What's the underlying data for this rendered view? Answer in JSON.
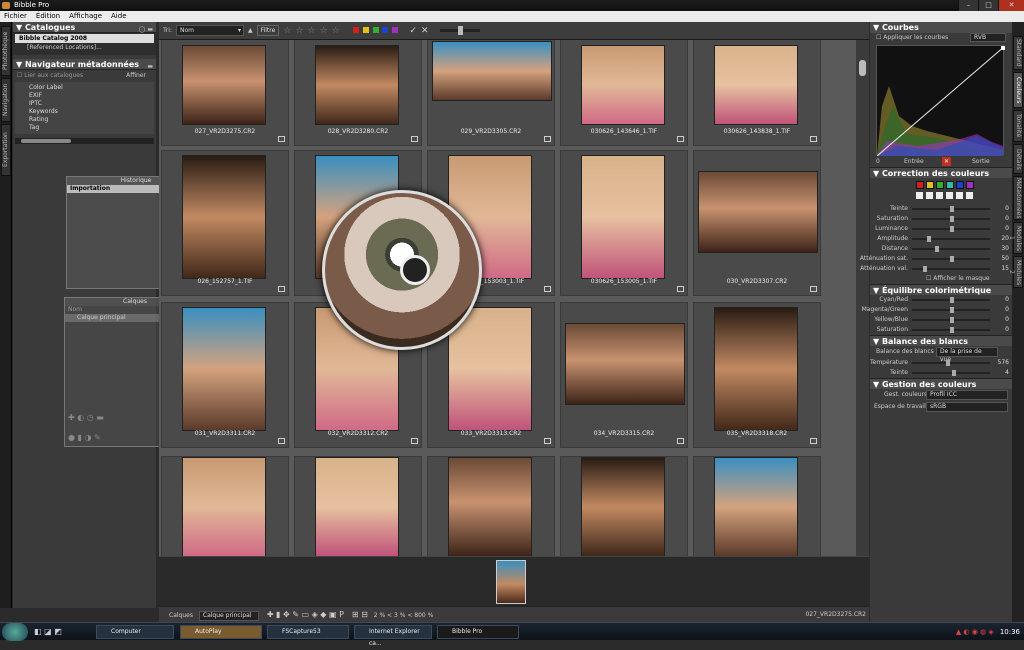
{
  "window": {
    "title": "Bibble Pro"
  },
  "menu": [
    "Fichier",
    "Édition",
    "Affichage",
    "Aide"
  ],
  "left_tabs": [
    "Photothèque",
    "Navigation",
    "Exportation"
  ],
  "catalogs": {
    "title": "Catalogues",
    "items": [
      "Bibble Catalog 2008",
      "[Referenced Locations]..."
    ]
  },
  "metadata": {
    "title": "Navigateur métadonnées",
    "link_option": "Lier aux catalogues",
    "refine_label": "Affiner",
    "items": [
      "Color Label",
      "EXIF",
      "IPTC",
      "Keywords",
      "Rating",
      "Tag"
    ]
  },
  "history": {
    "title": "Historique",
    "items": [
      "Importation"
    ]
  },
  "layers": {
    "title": "Calques",
    "column": "Nom",
    "items": [
      "Calque principal"
    ]
  },
  "toolbar": {
    "sort_label": "Tri:",
    "sort_value": "Nom",
    "filter_label": "Filtre",
    "label_colors": [
      "#d02020",
      "#e0c020",
      "#30b030",
      "#2040d0",
      "#a030c0"
    ]
  },
  "thumbnails": [
    [
      "027_VR2D3275.CR2",
      "028_VR2D3280.CR2",
      "029_VR2D3305.CR2",
      "030626_143646_1.TIF",
      "030626_143838_1.TIF"
    ],
    [
      "026_152757_1.TIF",
      "",
      "030626_153003_1.TIF",
      "030626_153005_1.TIF",
      "030_VR2D3307.CR2"
    ],
    [
      "031_VR2D3311.CR2",
      "032_VR2D3312.CR2",
      "033_VR2D3313.CR2",
      "034_VR2D3315.CR2",
      "035_VR2D3318.CR2"
    ],
    [
      "",
      "",
      "",
      "",
      ""
    ]
  ],
  "bottombar": {
    "layers_label": "Calques",
    "layer_value": "Calque principal",
    "zoom": "2 % < 3 % < 800 %",
    "filename": "027_VR2D3275.CR2"
  },
  "curves": {
    "title": "Courbes",
    "apply_label": "Appliquer les courbes",
    "channel": "RVB",
    "input_label": "Entrée",
    "output_label": "Sortie",
    "input_value": "0",
    "output_value": "0"
  },
  "color_correction": {
    "title": "Correction des couleurs",
    "swatches": [
      "#d02020",
      "#e0c020",
      "#30b030",
      "#2fbfa0",
      "#2040d0",
      "#a030c0"
    ],
    "rows": [
      {
        "label": "Teinte",
        "value": "0",
        "pos": 0.5
      },
      {
        "label": "Saturation",
        "value": "0",
        "pos": 0.5
      },
      {
        "label": "Luminance",
        "value": "0",
        "pos": 0.5
      },
      {
        "label": "Amplitude",
        "value": "20",
        "pos": 0.2
      },
      {
        "label": "Distance",
        "value": "30",
        "pos": 0.3
      },
      {
        "label": "Atténuation sat.",
        "value": "50",
        "pos": 0.5
      },
      {
        "label": "Atténuation val.",
        "value": "15",
        "pos": 0.15
      }
    ],
    "mask_label": "Afficher le masque"
  },
  "color_balance": {
    "title": "Équilibre colorimétrique",
    "rows": [
      {
        "label": "Cyan/Red",
        "value": "0",
        "pos": 0.5
      },
      {
        "label": "Magenta/Green",
        "value": "0",
        "pos": 0.5
      },
      {
        "label": "Yellow/Blue",
        "value": "0",
        "pos": 0.5
      },
      {
        "label": "Saturation",
        "value": "0",
        "pos": 0.5
      }
    ]
  },
  "white_balance": {
    "title": "Balance des blancs",
    "mode_label": "Balance des blancs",
    "mode_value": "De la prise de vue",
    "rows": [
      {
        "label": "Température",
        "value": "576",
        "pos": 0.45
      },
      {
        "label": "Teinte",
        "value": "4",
        "pos": 0.52
      }
    ]
  },
  "color_management": {
    "title": "Gestion des couleurs",
    "profile_label": "Gest. couleurs",
    "profile_value": "Profil ICC",
    "space_label": "Espace de travail",
    "space_value": "sRGB"
  },
  "right_tabs": [
    "Standard",
    "Couleurs",
    "Tonalité",
    "Détails",
    "Métadonnées",
    "Modules 1",
    "Modules 2"
  ],
  "taskbar": {
    "items": [
      "Computer",
      "AutoPlay",
      "FSCapture53",
      "Internet Explorer ca...",
      "Bibble Pro"
    ],
    "clock": "10:36"
  }
}
